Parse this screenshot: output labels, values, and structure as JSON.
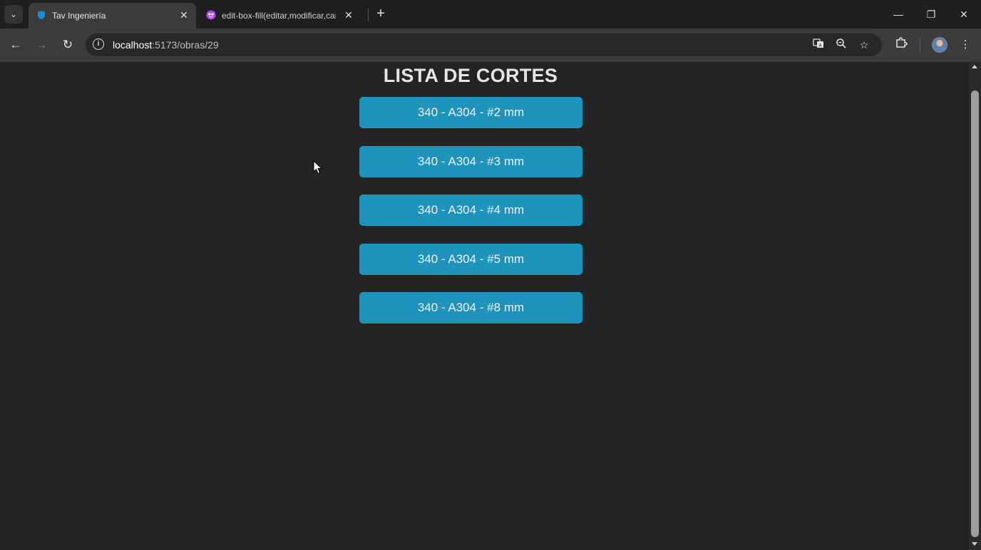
{
  "browser": {
    "tabs": [
      {
        "title": "Tav Ingeniería",
        "active": true
      },
      {
        "title": "edit-box-fill(editar,modificar,cambiar)",
        "active": false
      }
    ],
    "new_tab": "+",
    "address": {
      "host": "localhost",
      "path": ":5173/obras/29"
    },
    "window_controls": {
      "minimize": "—",
      "restore": "❐",
      "close": "✕"
    }
  },
  "page": {
    "title": "LISTA DE CORTES",
    "cuts": [
      {
        "label": "340 - A304 - #2 mm"
      },
      {
        "label": "340 - A304 - #3 mm"
      },
      {
        "label": "340 - A304 - #4 mm"
      },
      {
        "label": "340 - A304 - #5 mm"
      },
      {
        "label": "340 - A304 - #8 mm"
      }
    ]
  },
  "icons": {
    "tab_search": "chevron-down-icon",
    "tab_favicon_1": "shield-icon",
    "tab_favicon_2": "emoji-face-icon",
    "back": "arrow-left-icon",
    "forward": "arrow-right-icon",
    "reload": "reload-icon",
    "site_info": "info-icon",
    "translate": "translate-icon",
    "zoom": "zoom-icon",
    "bookmark": "star-icon",
    "extensions": "puzzle-icon",
    "menu": "kebab-menu-icon"
  },
  "colors": {
    "page_background": "#242424",
    "button_background": "#1e93bb",
    "button_text": "#f2f2f2",
    "title_text": "#e6e6e6"
  }
}
